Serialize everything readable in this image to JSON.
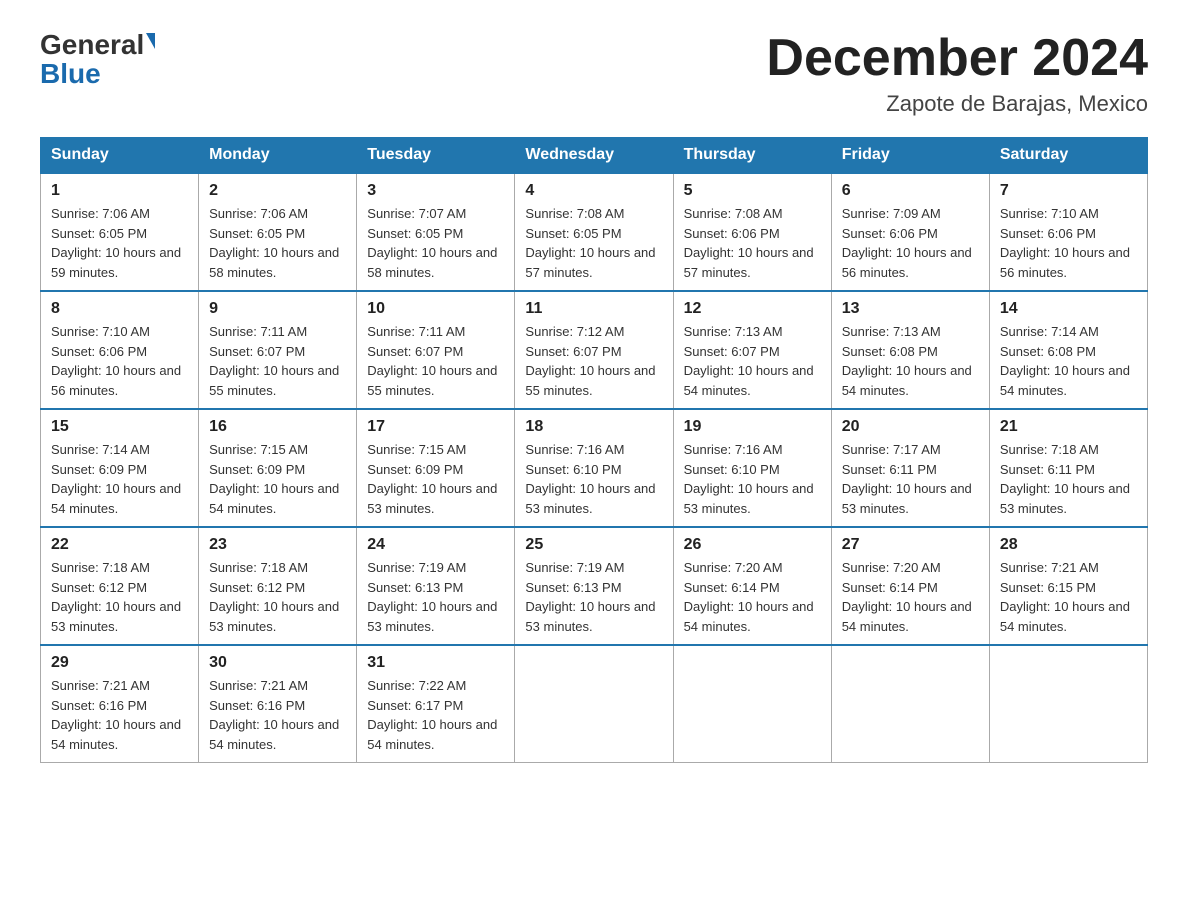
{
  "logo": {
    "text_general": "General",
    "text_blue": "Blue",
    "aria": "GeneralBlue logo"
  },
  "title": "December 2024",
  "location": "Zapote de Barajas, Mexico",
  "days_of_week": [
    "Sunday",
    "Monday",
    "Tuesday",
    "Wednesday",
    "Thursday",
    "Friday",
    "Saturday"
  ],
  "weeks": [
    [
      {
        "day": "1",
        "sunrise": "7:06 AM",
        "sunset": "6:05 PM",
        "daylight": "10 hours and 59 minutes."
      },
      {
        "day": "2",
        "sunrise": "7:06 AM",
        "sunset": "6:05 PM",
        "daylight": "10 hours and 58 minutes."
      },
      {
        "day": "3",
        "sunrise": "7:07 AM",
        "sunset": "6:05 PM",
        "daylight": "10 hours and 58 minutes."
      },
      {
        "day": "4",
        "sunrise": "7:08 AM",
        "sunset": "6:05 PM",
        "daylight": "10 hours and 57 minutes."
      },
      {
        "day": "5",
        "sunrise": "7:08 AM",
        "sunset": "6:06 PM",
        "daylight": "10 hours and 57 minutes."
      },
      {
        "day": "6",
        "sunrise": "7:09 AM",
        "sunset": "6:06 PM",
        "daylight": "10 hours and 56 minutes."
      },
      {
        "day": "7",
        "sunrise": "7:10 AM",
        "sunset": "6:06 PM",
        "daylight": "10 hours and 56 minutes."
      }
    ],
    [
      {
        "day": "8",
        "sunrise": "7:10 AM",
        "sunset": "6:06 PM",
        "daylight": "10 hours and 56 minutes."
      },
      {
        "day": "9",
        "sunrise": "7:11 AM",
        "sunset": "6:07 PM",
        "daylight": "10 hours and 55 minutes."
      },
      {
        "day": "10",
        "sunrise": "7:11 AM",
        "sunset": "6:07 PM",
        "daylight": "10 hours and 55 minutes."
      },
      {
        "day": "11",
        "sunrise": "7:12 AM",
        "sunset": "6:07 PM",
        "daylight": "10 hours and 55 minutes."
      },
      {
        "day": "12",
        "sunrise": "7:13 AM",
        "sunset": "6:07 PM",
        "daylight": "10 hours and 54 minutes."
      },
      {
        "day": "13",
        "sunrise": "7:13 AM",
        "sunset": "6:08 PM",
        "daylight": "10 hours and 54 minutes."
      },
      {
        "day": "14",
        "sunrise": "7:14 AM",
        "sunset": "6:08 PM",
        "daylight": "10 hours and 54 minutes."
      }
    ],
    [
      {
        "day": "15",
        "sunrise": "7:14 AM",
        "sunset": "6:09 PM",
        "daylight": "10 hours and 54 minutes."
      },
      {
        "day": "16",
        "sunrise": "7:15 AM",
        "sunset": "6:09 PM",
        "daylight": "10 hours and 54 minutes."
      },
      {
        "day": "17",
        "sunrise": "7:15 AM",
        "sunset": "6:09 PM",
        "daylight": "10 hours and 53 minutes."
      },
      {
        "day": "18",
        "sunrise": "7:16 AM",
        "sunset": "6:10 PM",
        "daylight": "10 hours and 53 minutes."
      },
      {
        "day": "19",
        "sunrise": "7:16 AM",
        "sunset": "6:10 PM",
        "daylight": "10 hours and 53 minutes."
      },
      {
        "day": "20",
        "sunrise": "7:17 AM",
        "sunset": "6:11 PM",
        "daylight": "10 hours and 53 minutes."
      },
      {
        "day": "21",
        "sunrise": "7:18 AM",
        "sunset": "6:11 PM",
        "daylight": "10 hours and 53 minutes."
      }
    ],
    [
      {
        "day": "22",
        "sunrise": "7:18 AM",
        "sunset": "6:12 PM",
        "daylight": "10 hours and 53 minutes."
      },
      {
        "day": "23",
        "sunrise": "7:18 AM",
        "sunset": "6:12 PM",
        "daylight": "10 hours and 53 minutes."
      },
      {
        "day": "24",
        "sunrise": "7:19 AM",
        "sunset": "6:13 PM",
        "daylight": "10 hours and 53 minutes."
      },
      {
        "day": "25",
        "sunrise": "7:19 AM",
        "sunset": "6:13 PM",
        "daylight": "10 hours and 53 minutes."
      },
      {
        "day": "26",
        "sunrise": "7:20 AM",
        "sunset": "6:14 PM",
        "daylight": "10 hours and 54 minutes."
      },
      {
        "day": "27",
        "sunrise": "7:20 AM",
        "sunset": "6:14 PM",
        "daylight": "10 hours and 54 minutes."
      },
      {
        "day": "28",
        "sunrise": "7:21 AM",
        "sunset": "6:15 PM",
        "daylight": "10 hours and 54 minutes."
      }
    ],
    [
      {
        "day": "29",
        "sunrise": "7:21 AM",
        "sunset": "6:16 PM",
        "daylight": "10 hours and 54 minutes."
      },
      {
        "day": "30",
        "sunrise": "7:21 AM",
        "sunset": "6:16 PM",
        "daylight": "10 hours and 54 minutes."
      },
      {
        "day": "31",
        "sunrise": "7:22 AM",
        "sunset": "6:17 PM",
        "daylight": "10 hours and 54 minutes."
      },
      null,
      null,
      null,
      null
    ]
  ]
}
